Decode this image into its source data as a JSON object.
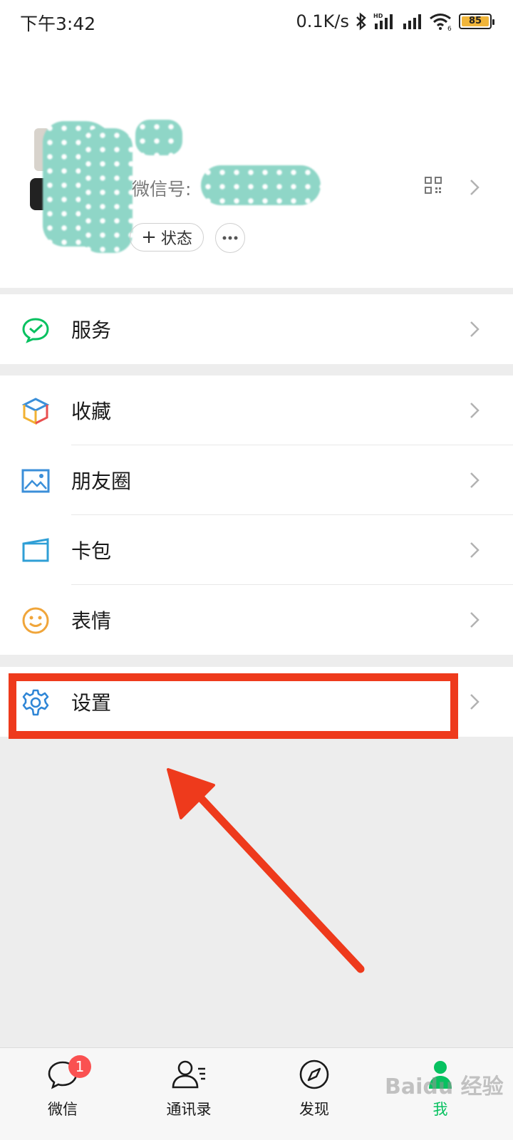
{
  "status_bar": {
    "time": "下午3:42",
    "net_speed": "0.1K/s",
    "battery": "85",
    "hd_label": "HD",
    "wifi_label": "6"
  },
  "profile": {
    "wechat_id_label": "微信号:",
    "status_button_label": "状态"
  },
  "menu": {
    "service": "服务",
    "favorites": "收藏",
    "moments": "朋友圈",
    "cards": "卡包",
    "stickers": "表情",
    "settings": "设置"
  },
  "tabs": [
    {
      "label": "微信",
      "badge": "1"
    },
    {
      "label": "通讯录"
    },
    {
      "label": "发现"
    },
    {
      "label": "我"
    }
  ],
  "colors": {
    "accent": "#07c160",
    "highlight": "#ee3a1c",
    "badge": "#fa5151"
  },
  "watermark": "Baidu 经验"
}
